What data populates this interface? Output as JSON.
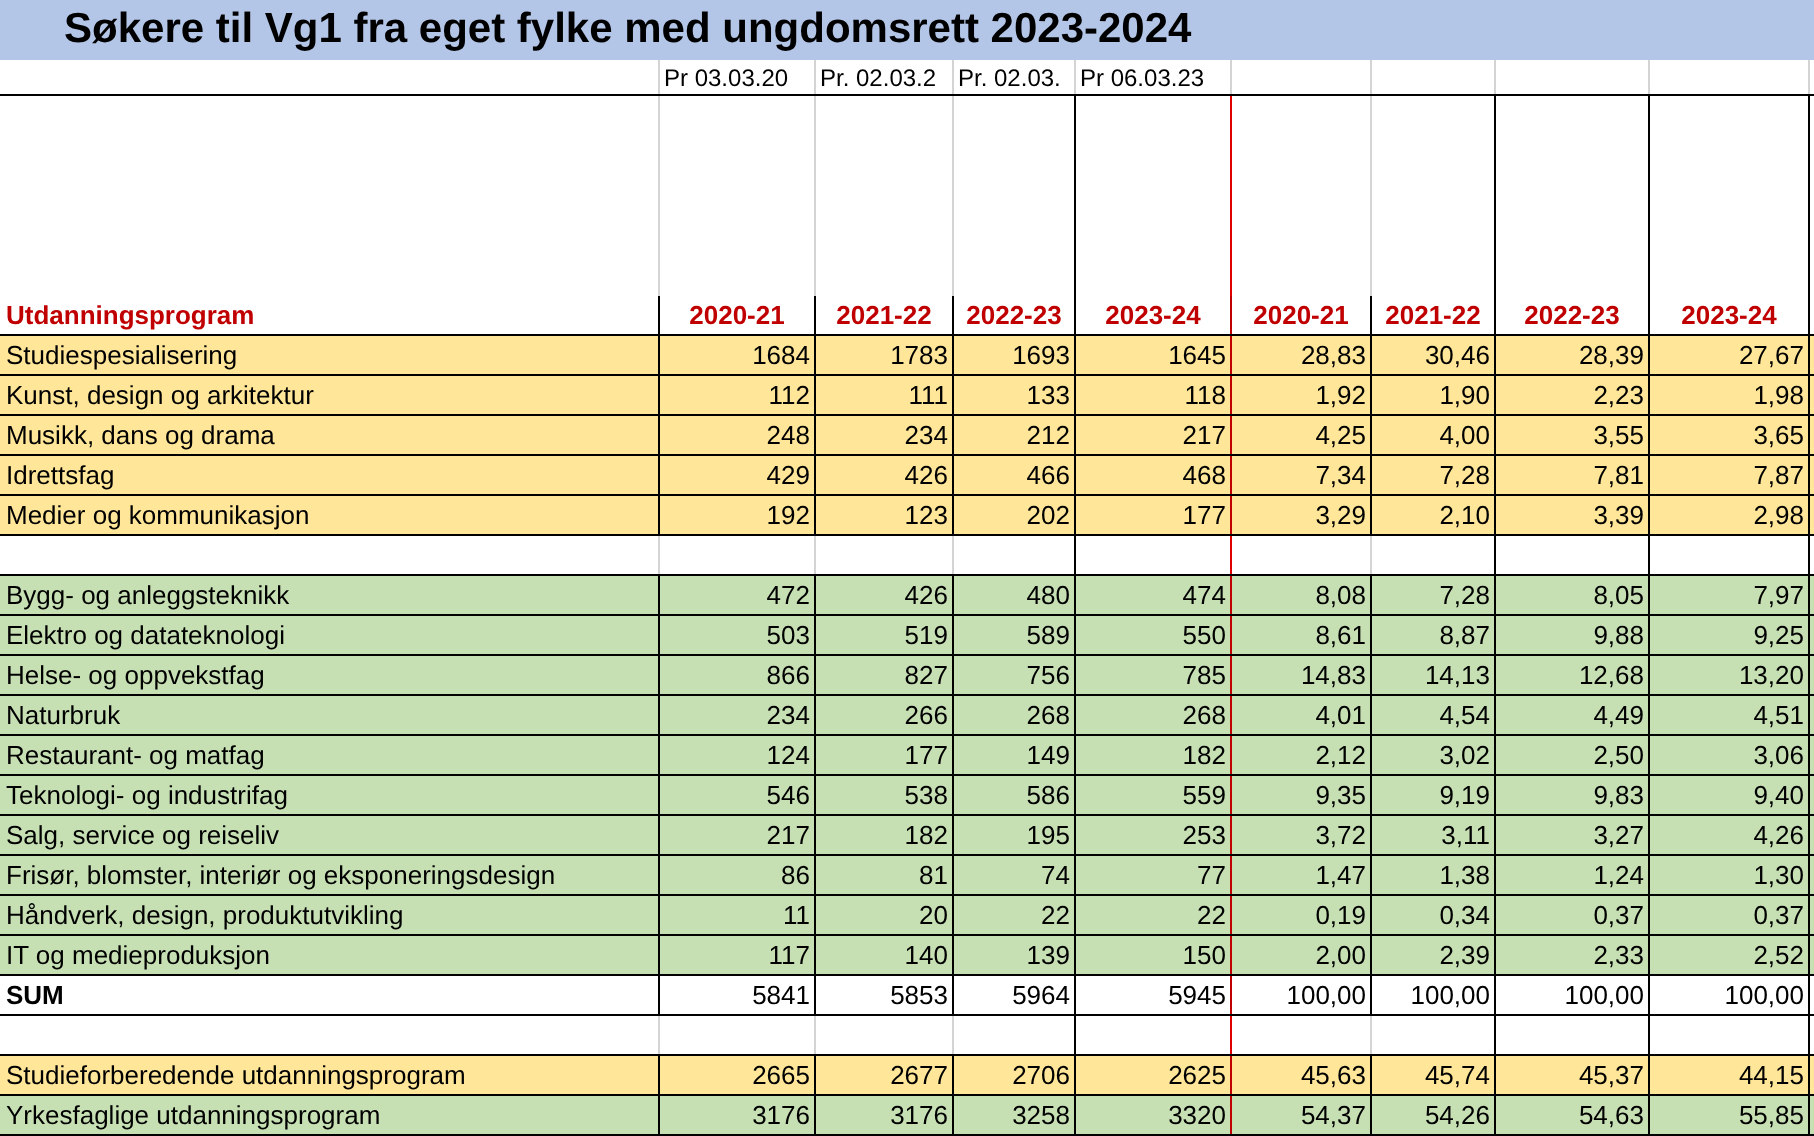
{
  "title": "Søkere til Vg1 fra eget fylke med ungdomsrett 2023-2024",
  "date_row": [
    "Pr 03.03.20",
    "Pr. 02.03.2",
    "Pr. 02.03.",
    "Pr 06.03.23"
  ],
  "columns": [
    "Utdanningsprogram",
    "2020-21",
    "2021-22",
    "2022-23",
    "2023-24",
    "2020-21",
    "2021-22",
    "2022-23",
    "2023-24"
  ],
  "rows": [
    {
      "kind": "data",
      "color": "#ffe699",
      "cells": [
        "Studiespesialisering",
        "1684",
        "1783",
        "1693",
        "1645",
        "28,83",
        "30,46",
        "28,39",
        "27,67"
      ]
    },
    {
      "kind": "data",
      "color": "#ffe699",
      "cells": [
        "Kunst, design og arkitektur",
        "112",
        "111",
        "133",
        "118",
        "1,92",
        "1,90",
        "2,23",
        "1,98"
      ]
    },
    {
      "kind": "data",
      "color": "#ffe699",
      "cells": [
        "Musikk, dans og drama",
        "248",
        "234",
        "212",
        "217",
        "4,25",
        "4,00",
        "3,55",
        "3,65"
      ]
    },
    {
      "kind": "data",
      "color": "#ffe699",
      "cells": [
        "Idrettsfag",
        "429",
        "426",
        "466",
        "468",
        "7,34",
        "7,28",
        "7,81",
        "7,87"
      ]
    },
    {
      "kind": "data",
      "color": "#ffe699",
      "cells": [
        "Medier og kommunikasjon",
        "192",
        "123",
        "202",
        "177",
        "3,29",
        "2,10",
        "3,39",
        "2,98"
      ]
    },
    {
      "kind": "spacer"
    },
    {
      "kind": "data",
      "color": "#c6e0b4",
      "cells": [
        "Bygg- og anleggsteknikk",
        "472",
        "426",
        "480",
        "474",
        "8,08",
        "7,28",
        "8,05",
        "7,97"
      ]
    },
    {
      "kind": "data",
      "color": "#c6e0b4",
      "cells": [
        "Elektro og datateknologi",
        "503",
        "519",
        "589",
        "550",
        "8,61",
        "8,87",
        "9,88",
        "9,25"
      ]
    },
    {
      "kind": "data",
      "color": "#c6e0b4",
      "cells": [
        "Helse- og oppvekstfag",
        "866",
        "827",
        "756",
        "785",
        "14,83",
        "14,13",
        "12,68",
        "13,20"
      ]
    },
    {
      "kind": "data",
      "color": "#c6e0b4",
      "cells": [
        "Naturbruk",
        "234",
        "266",
        "268",
        "268",
        "4,01",
        "4,54",
        "4,49",
        "4,51"
      ]
    },
    {
      "kind": "data",
      "color": "#c6e0b4",
      "cells": [
        "Restaurant- og matfag",
        "124",
        "177",
        "149",
        "182",
        "2,12",
        "3,02",
        "2,50",
        "3,06"
      ]
    },
    {
      "kind": "data",
      "color": "#c6e0b4",
      "cells": [
        "Teknologi- og industrifag",
        "546",
        "538",
        "586",
        "559",
        "9,35",
        "9,19",
        "9,83",
        "9,40"
      ]
    },
    {
      "kind": "data",
      "color": "#c6e0b4",
      "cells": [
        "Salg, service og reiseliv",
        "217",
        "182",
        "195",
        "253",
        "3,72",
        "3,11",
        "3,27",
        "4,26"
      ]
    },
    {
      "kind": "data",
      "color": "#c6e0b4",
      "cells": [
        "Frisør, blomster, interiør og eksponeringsdesign",
        "86",
        "81",
        "74",
        "77",
        "1,47",
        "1,38",
        "1,24",
        "1,30"
      ]
    },
    {
      "kind": "data",
      "color": "#c6e0b4",
      "cells": [
        "Håndverk, design, produktutvikling",
        "11",
        "20",
        "22",
        "22",
        "0,19",
        "0,34",
        "0,37",
        "0,37"
      ]
    },
    {
      "kind": "data",
      "color": "#c6e0b4",
      "cells": [
        "IT og medieproduksjon",
        "117",
        "140",
        "139",
        "150",
        "2,00",
        "2,39",
        "2,33",
        "2,52"
      ]
    },
    {
      "kind": "sum",
      "cells": [
        "SUM",
        "5841",
        "5853",
        "5964",
        "5945",
        "100,00",
        "100,00",
        "100,00",
        "100,00"
      ]
    },
    {
      "kind": "spacer"
    },
    {
      "kind": "data",
      "color": "#ffe699",
      "cells": [
        "Studieforberedende utdanningsprogram",
        "2665",
        "2677",
        "2706",
        "2625",
        "45,63",
        "45,74",
        "45,37",
        "44,15"
      ]
    },
    {
      "kind": "data",
      "color": "#c6e0b4",
      "cells": [
        "Yrkesfaglige utdanningsprogram",
        "3176",
        "3176",
        "3258",
        "3320",
        "54,37",
        "54,26",
        "54,63",
        "55,85"
      ]
    }
  ]
}
